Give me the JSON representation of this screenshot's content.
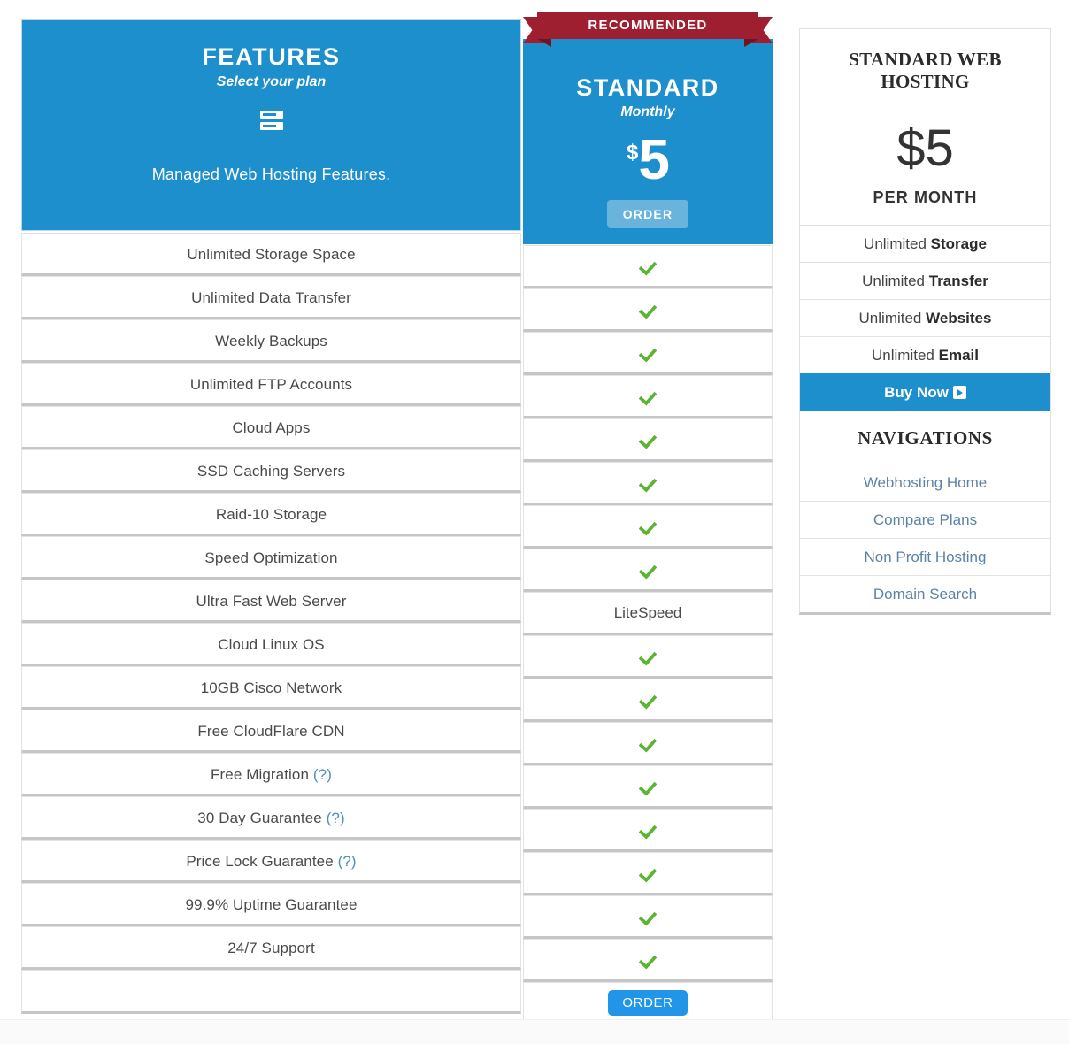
{
  "colors": {
    "accent_blue": "#1e8fcd",
    "ribbon_red": "#9e1f2f",
    "check_green": "#5cb531",
    "link_blue": "#5b83a8",
    "order_button_blue": "#2196e8"
  },
  "features_column": {
    "title": "FEATURES",
    "subtitle": "Select your plan",
    "icon": "server-stack-icon",
    "description": "Managed Web Hosting Features.",
    "rows": [
      {
        "label": "Unlimited Storage Space",
        "help": ""
      },
      {
        "label": "Unlimited Data Transfer",
        "help": ""
      },
      {
        "label": "Weekly Backups",
        "help": ""
      },
      {
        "label": "Unlimited FTP Accounts",
        "help": ""
      },
      {
        "label": "Cloud Apps",
        "help": ""
      },
      {
        "label": "SSD Caching Servers",
        "help": ""
      },
      {
        "label": "Raid-10 Storage",
        "help": ""
      },
      {
        "label": "Speed Optimization",
        "help": ""
      },
      {
        "label": "Ultra Fast Web Server",
        "help": ""
      },
      {
        "label": "Cloud Linux OS",
        "help": ""
      },
      {
        "label": "10GB Cisco Network",
        "help": ""
      },
      {
        "label": "Free CloudFlare CDN",
        "help": ""
      },
      {
        "label": "Free Migration",
        "help": "(?)"
      },
      {
        "label": "30 Day Guarantee",
        "help": "(?)"
      },
      {
        "label": "Price Lock Guarantee",
        "help": "(?)"
      },
      {
        "label": "99.9% Uptime Guarantee",
        "help": ""
      },
      {
        "label": "24/7 Support",
        "help": ""
      },
      {
        "label": "",
        "help": ""
      }
    ]
  },
  "plan_column": {
    "ribbon_label": "RECOMMENDED",
    "name": "STANDARD",
    "period": "Monthly",
    "currency": "$",
    "amount": "5",
    "order_label_top": "ORDER",
    "order_label_bottom": "ORDER",
    "values": [
      {
        "type": "check",
        "text": ""
      },
      {
        "type": "check",
        "text": ""
      },
      {
        "type": "check",
        "text": ""
      },
      {
        "type": "check",
        "text": ""
      },
      {
        "type": "check",
        "text": ""
      },
      {
        "type": "check",
        "text": ""
      },
      {
        "type": "check",
        "text": ""
      },
      {
        "type": "check",
        "text": ""
      },
      {
        "type": "text",
        "text": "LiteSpeed"
      },
      {
        "type": "check",
        "text": ""
      },
      {
        "type": "check",
        "text": ""
      },
      {
        "type": "check",
        "text": ""
      },
      {
        "type": "check",
        "text": ""
      },
      {
        "type": "check",
        "text": ""
      },
      {
        "type": "check",
        "text": ""
      },
      {
        "type": "check",
        "text": ""
      },
      {
        "type": "check",
        "text": ""
      },
      {
        "type": "order",
        "text": "ORDER"
      }
    ]
  },
  "sidebar": {
    "title": "STANDARD WEB HOSTING",
    "price": "$5",
    "per_label": "PER MONTH",
    "specs": [
      {
        "prefix": "Unlimited ",
        "strong": "Storage"
      },
      {
        "prefix": "Unlimited ",
        "strong": "Transfer"
      },
      {
        "prefix": "Unlimited ",
        "strong": "Websites"
      },
      {
        "prefix": "Unlimited ",
        "strong": "Email"
      }
    ],
    "buy_label": "Buy Now",
    "buy_icon": "play-box-icon",
    "nav_heading": "NAVIGATIONS",
    "nav_links": [
      "Webhosting Home",
      "Compare Plans",
      "Non Profit Hosting",
      "Domain Search"
    ]
  }
}
